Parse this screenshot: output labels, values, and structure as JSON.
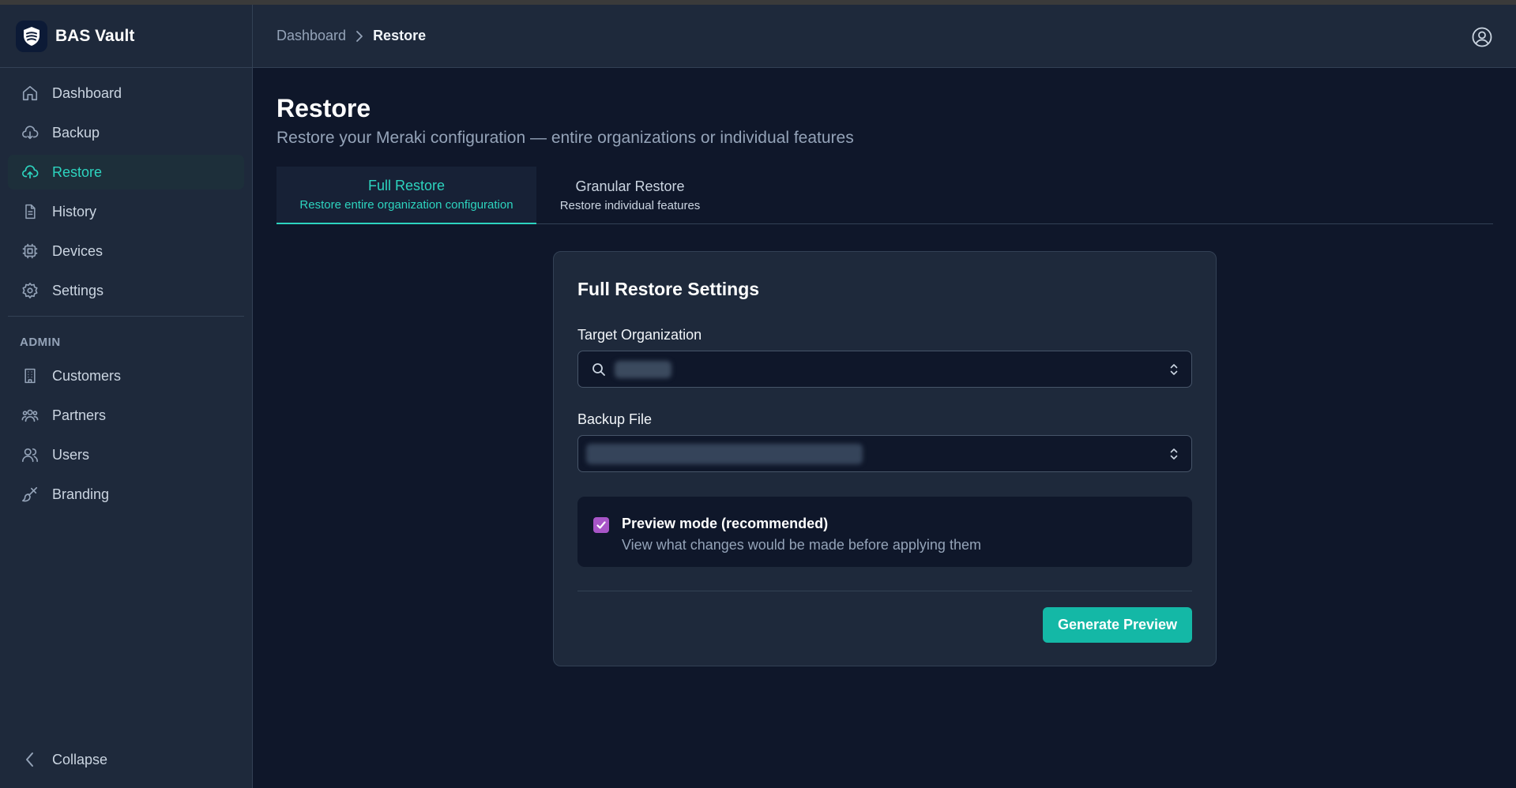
{
  "app": {
    "name": "BAS Vault"
  },
  "sidebar": {
    "items": [
      {
        "label": "Dashboard",
        "icon": "home-icon"
      },
      {
        "label": "Backup",
        "icon": "cloud-download-icon"
      },
      {
        "label": "Restore",
        "icon": "cloud-upload-icon",
        "active": true
      },
      {
        "label": "History",
        "icon": "file-icon"
      },
      {
        "label": "Devices",
        "icon": "chip-icon"
      },
      {
        "label": "Settings",
        "icon": "gear-icon"
      }
    ],
    "admin_label": "ADMIN",
    "admin_items": [
      {
        "label": "Customers",
        "icon": "building-icon"
      },
      {
        "label": "Partners",
        "icon": "group-icon"
      },
      {
        "label": "Users",
        "icon": "users-icon"
      },
      {
        "label": "Branding",
        "icon": "brush-icon"
      }
    ],
    "collapse_label": "Collapse"
  },
  "header": {
    "breadcrumb": {
      "parent": "Dashboard",
      "current": "Restore"
    }
  },
  "page": {
    "title": "Restore",
    "subtitle": "Restore your Meraki configuration — entire organizations or individual features"
  },
  "tabs": [
    {
      "title": "Full Restore",
      "desc": "Restore entire organization configuration",
      "active": true
    },
    {
      "title": "Granular Restore",
      "desc": "Restore individual features",
      "active": false
    }
  ],
  "card": {
    "title": "Full Restore Settings",
    "target_org_label": "Target Organization",
    "backup_file_label": "Backup File",
    "preview_title": "Preview mode (recommended)",
    "preview_desc": "View what changes would be made before applying them",
    "preview_checked": true,
    "generate_button": "Generate Preview"
  },
  "colors": {
    "accent": "#2dd4bf",
    "button": "#14b8a6",
    "checkbox": "#a855c7",
    "background": "#0f172a",
    "panel": "#1e293b"
  }
}
